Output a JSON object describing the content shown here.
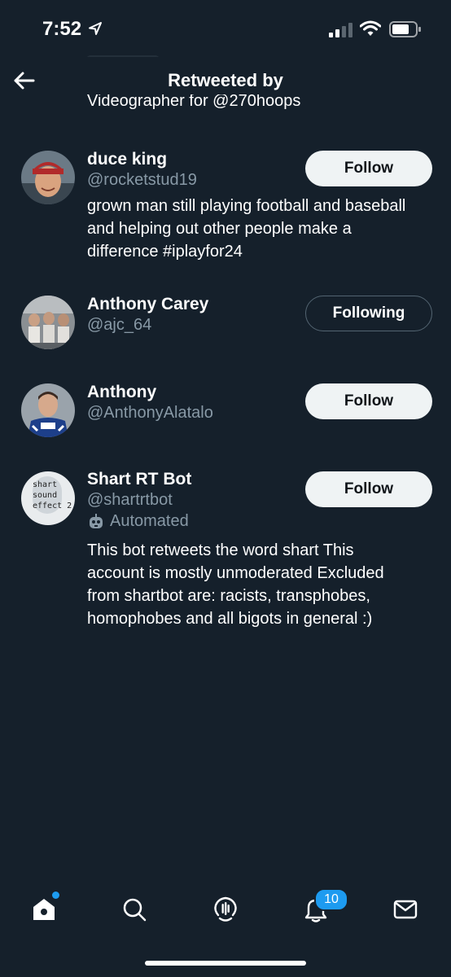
{
  "status_bar": {
    "time": "7:52"
  },
  "header": {
    "title": "Retweeted by"
  },
  "cutoff_bio": "Videographer for @270hoops",
  "users": [
    {
      "name": "duce king",
      "handle": "@rocketstud19",
      "bio_lines": [
        "grown man still playing football and baseball",
        "and helping out other people make a",
        "difference #iplayfor24"
      ],
      "button": "Follow"
    },
    {
      "name": "Anthony Carey",
      "handle": "@ajc_64",
      "button": "Following"
    },
    {
      "name": "Anthony",
      "handle": "@AnthonyAlatalo",
      "button": "Follow"
    },
    {
      "name": "Shart RT Bot",
      "handle": "@shartrtbot",
      "automated_label": "Automated",
      "avatar_text": [
        "shart",
        "sound",
        "effect 2"
      ],
      "bio_lines": [
        "This bot retweets the word shart This",
        "account is mostly unmoderated Excluded",
        "from shartbot are: racists, transphobes,",
        "homophobes and all bigots in general :)"
      ],
      "button": "Follow"
    }
  ],
  "nav": {
    "items": [
      "home-icon",
      "search-icon",
      "spaces-icon",
      "notifications-icon",
      "messages-icon"
    ],
    "notification_count": "10"
  },
  "colors": {
    "background": "#15202b",
    "secondary_text": "#8899a6",
    "accent": "#1d9bf0",
    "button_bg": "#eff3f4"
  }
}
